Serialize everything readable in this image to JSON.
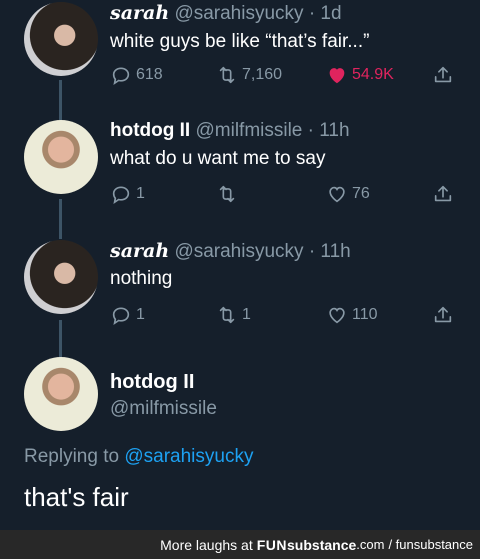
{
  "tweets": [
    {
      "name": "sarah",
      "handle": "@sarahisyucky",
      "time": "· 1d",
      "text": "white guys be like “that’s fair...”",
      "reply_count": "618",
      "retweet_count": "7,160",
      "like_count": "54.9K",
      "liked": true,
      "avatar_icon": "avatar-photo"
    },
    {
      "name": "hotdog II",
      "handle": "@milfmissile",
      "time": "· 11h",
      "text": "what do u want me to say",
      "reply_count": "1",
      "retweet_count": "",
      "like_count": "76",
      "liked": false,
      "avatar_icon": "avatar-photo"
    },
    {
      "name": "sarah",
      "handle": "@sarahisyucky",
      "time": "· 11h",
      "text": "nothing",
      "reply_count": "1",
      "retweet_count": "1",
      "like_count": "110",
      "liked": false,
      "avatar_icon": "avatar-photo"
    }
  ],
  "focused": {
    "name": "hotdog II",
    "handle": "@milfmissile",
    "replying_prefix": "Replying to",
    "replying_handle": "@sarahisyucky",
    "text": "that's fair"
  },
  "footer": {
    "prefix": "More laughs at",
    "brand_a": "FUN",
    "brand_b": "substance",
    "brand_c": ".com",
    "brand_suffix": "/ funsubstance"
  },
  "colors": {
    "background": "#151f2b",
    "secondary_text": "#8899a6",
    "link": "#1da1f2",
    "like": "#e0245e",
    "connector": "#3d5466"
  },
  "icons": [
    "reply-icon",
    "retweet-icon",
    "like-icon",
    "share-icon"
  ]
}
